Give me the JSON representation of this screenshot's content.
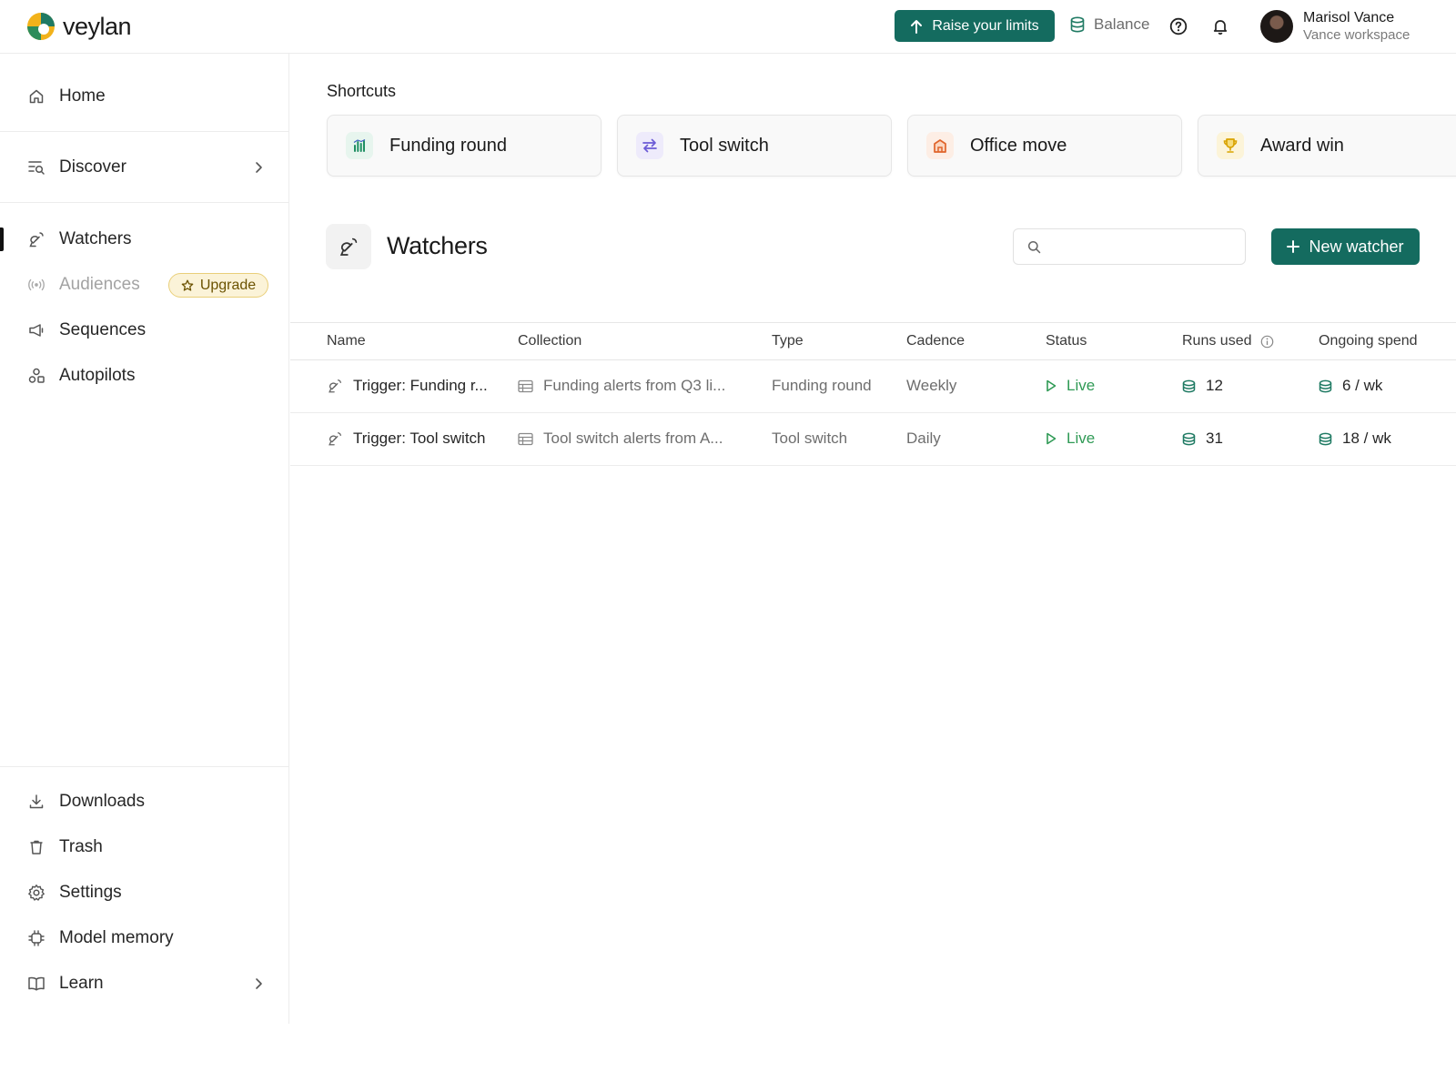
{
  "app": {
    "brand": "veylan",
    "accent_color": "#146b5f"
  },
  "topbar": {
    "raise_label": "Raise your limits",
    "balance_label": "Balance",
    "help_icon": "question-circle-icon",
    "bell_icon": "bell-icon",
    "user_name": "Marisol Vance",
    "workspace": "Vance workspace"
  },
  "sidebar": {
    "home": "Home",
    "discover": "Discover",
    "watchers": "Watchers",
    "audiences": "Audiences",
    "upgrade": "Upgrade",
    "sequences": "Sequences",
    "autopilots": "Autopilots",
    "downloads": "Downloads",
    "trash": "Trash",
    "settings": "Settings",
    "model_memory": "Model memory",
    "learn": "Learn"
  },
  "shortcuts": {
    "title": "Shortcuts",
    "items": [
      {
        "label": "Funding round",
        "icon": "bar-chart-icon",
        "color": "#1f8f63"
      },
      {
        "label": "Tool switch",
        "icon": "arrows-swap-icon",
        "color": "#6b5bd6"
      },
      {
        "label": "Office move",
        "icon": "building-icon",
        "color": "#e0642b"
      },
      {
        "label": "Award win",
        "icon": "trophy-icon",
        "color": "#d9a300"
      }
    ]
  },
  "watchers": {
    "title": "Watchers",
    "search_placeholder": "",
    "new_label": "New watcher",
    "columns": {
      "name": "Name",
      "collection": "Collection",
      "type": "Type",
      "cadence": "Cadence",
      "status": "Status",
      "runs": "Runs used",
      "spend": "Ongoing spend"
    },
    "rows": [
      {
        "name": "Trigger: Funding r...",
        "collection": "Funding alerts from Q3 li...",
        "type": "Funding round",
        "cadence": "Weekly",
        "status": "Live",
        "runs": "12",
        "spend": "6 / wk"
      },
      {
        "name": "Trigger: Tool switch",
        "collection": "Tool switch alerts from A...",
        "type": "Tool switch",
        "cadence": "Daily",
        "status": "Live",
        "runs": "31",
        "spend": "18 / wk"
      }
    ]
  }
}
